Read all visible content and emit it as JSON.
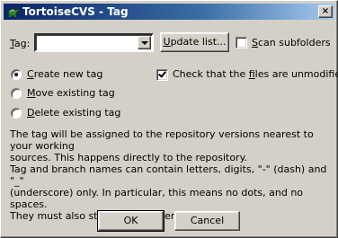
{
  "window": {
    "title": "TortoiseCVS - Tag",
    "close_glyph": "×"
  },
  "tag": {
    "label_pre": "",
    "label_mnemonic": "T",
    "label_post": "ag:",
    "value": ""
  },
  "update_button": {
    "pre": "",
    "mnemonic": "U",
    "post": "pdate list..."
  },
  "scan_subfolders": {
    "pre": "",
    "mnemonic": "S",
    "post": "can subfolders",
    "checked": false
  },
  "options": [
    {
      "pre": "",
      "mnemonic": "C",
      "post": "reate new tag",
      "checked": true
    },
    {
      "pre": "",
      "mnemonic": "M",
      "post": "ove existing tag",
      "checked": false
    },
    {
      "pre": "",
      "mnemonic": "D",
      "post": "elete existing tag",
      "checked": false
    }
  ],
  "check_unmodified": {
    "pre": "Check that the ",
    "mnemonic": "f",
    "post": "iles are unmodified",
    "checked": true
  },
  "info": {
    "line1": "The tag will be assigned to the repository versions nearest to your working",
    "line2": "sources. This happens directly to the repository.",
    "line3": "Tag and branch names can contain letters, digits, \"-\" (dash) and \"_\"",
    "line4": "(underscore) only. In particular, this means no dots, and no spaces.",
    "line5": "They must also start with a letter."
  },
  "buttons": {
    "ok": "OK",
    "cancel": "Cancel"
  },
  "colors": {
    "title_start": "#0a246a",
    "title_end": "#a6caf0",
    "face": "#d4d0c8"
  },
  "icons": {
    "app": "tortoise-icon",
    "close": "close-icon",
    "dropdown": "chevron-down-icon"
  }
}
